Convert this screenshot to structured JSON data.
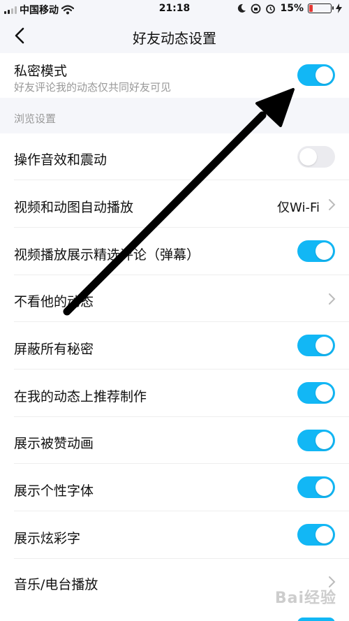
{
  "status_bar": {
    "carrier": "中国移动",
    "time": "21:18",
    "battery": "15%",
    "battery_level": 0.15,
    "battery_color": "#e53935"
  },
  "nav": {
    "title": "好友动态设置",
    "back_icon": "chevron-left-icon"
  },
  "privacy": {
    "label": "私密模式",
    "desc": "好友评论我的动态仅共同好友可见",
    "enabled": true
  },
  "browse_section": {
    "header": "浏览设置",
    "items": [
      {
        "label": "操作音效和震动",
        "type": "toggle",
        "enabled": false
      },
      {
        "label": "视频和动图自动播放",
        "type": "link",
        "value": "仅Wi-Fi"
      },
      {
        "label": "视频播放展示精选评论（弹幕）",
        "type": "toggle",
        "enabled": true
      },
      {
        "label": "不看他的动态",
        "type": "link"
      },
      {
        "label": "屏蔽所有秘密",
        "type": "toggle",
        "enabled": true
      },
      {
        "label": "在我的动态上推荐制作",
        "type": "toggle",
        "enabled": true
      },
      {
        "label": "展示被赞动画",
        "type": "toggle",
        "enabled": true
      },
      {
        "label": "展示个性字体",
        "type": "toggle",
        "enabled": true
      },
      {
        "label": "展示炫彩字",
        "type": "toggle",
        "enabled": true
      },
      {
        "label": "音乐/电台播放",
        "type": "link"
      }
    ]
  },
  "colors": {
    "toggle_on": "#12b7f5",
    "toggle_off": "#ebebef",
    "background": "#f5f6fa"
  },
  "watermark": "Bai经验"
}
